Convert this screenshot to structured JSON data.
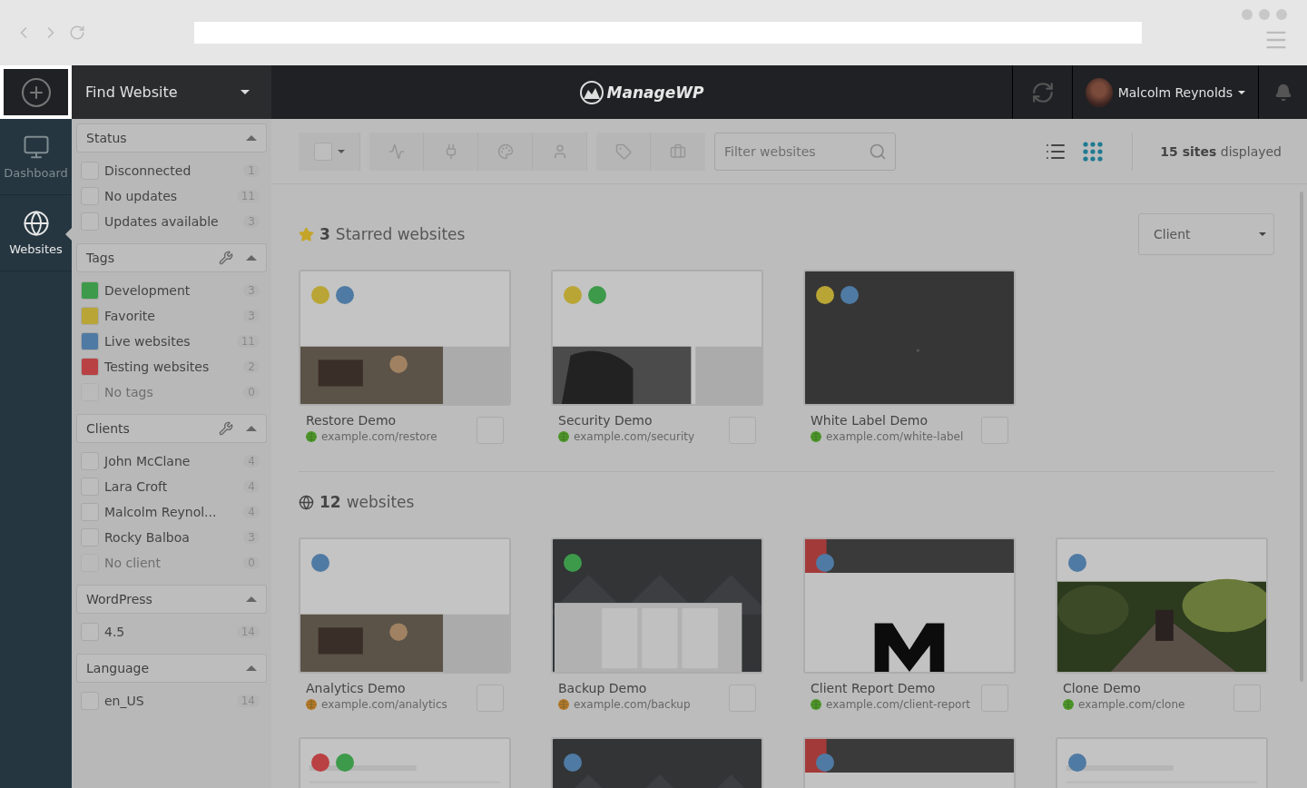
{
  "header": {
    "find_website": "Find Website",
    "logo": "ManageWP",
    "user": "Malcolm Reynolds"
  },
  "nav": [
    {
      "label": "Dashboard",
      "selected": false
    },
    {
      "label": "Websites",
      "selected": true
    }
  ],
  "filters": [
    {
      "title": "Status",
      "wrench": false,
      "items": [
        {
          "kind": "checkbox",
          "label": "Disconnected",
          "count": "1",
          "disabled": false
        },
        {
          "kind": "checkbox",
          "label": "No updates",
          "count": "11",
          "disabled": false
        },
        {
          "kind": "checkbox",
          "label": "Updates available",
          "count": "3",
          "disabled": false
        }
      ]
    },
    {
      "title": "Tags",
      "wrench": true,
      "items": [
        {
          "kind": "tag",
          "label": "Development",
          "count": "3",
          "color": "#3d9a4a",
          "disabled": false
        },
        {
          "kind": "tag",
          "label": "Favorite",
          "count": "3",
          "color": "#b9a535",
          "disabled": false
        },
        {
          "kind": "tag",
          "label": "Live websites",
          "count": "11",
          "color": "#4f7aa3",
          "disabled": false
        },
        {
          "kind": "tag",
          "label": "Testing websites",
          "count": "2",
          "color": "#b94143",
          "disabled": false
        },
        {
          "kind": "checkbox",
          "label": "No tags",
          "count": "0",
          "disabled": true
        }
      ]
    },
    {
      "title": "Clients",
      "wrench": true,
      "items": [
        {
          "kind": "checkbox",
          "label": "John McClane",
          "count": "4",
          "disabled": false
        },
        {
          "kind": "checkbox",
          "label": "Lara Croft",
          "count": "4",
          "disabled": false
        },
        {
          "kind": "checkbox",
          "label": "Malcolm Reynol...",
          "count": "4",
          "disabled": false
        },
        {
          "kind": "checkbox",
          "label": "Rocky Balboa",
          "count": "3",
          "disabled": false
        },
        {
          "kind": "checkbox",
          "label": "No client",
          "count": "0",
          "disabled": true
        }
      ]
    },
    {
      "title": "WordPress",
      "wrench": false,
      "items": [
        {
          "kind": "checkbox",
          "label": "4.5",
          "count": "14",
          "disabled": false
        }
      ]
    },
    {
      "title": "Language",
      "wrench": false,
      "items": [
        {
          "kind": "checkbox",
          "label": "en_US",
          "count": "14",
          "disabled": false
        }
      ]
    }
  ],
  "toolbar": {
    "placeholder": "Filter websites",
    "views": [
      {
        "selected": false
      },
      {
        "selected": true
      }
    ],
    "sites_count": "**15 sites** displayed"
  },
  "sort": "Client",
  "groups": [
    {
      "count": "3",
      "heading": "Starred websites",
      "sites": [
        {
          "title": "Restore Demo",
          "url": "example.com/restore",
          "color": "#4f9a2c",
          "selected": false,
          "tags": [
            {
              "color": "#b9a535"
            },
            {
              "color": "#4f7aa3"
            }
          ]
        },
        {
          "title": "Security Demo",
          "url": "example.com/security",
          "color": "#4f9a2c",
          "selected": false,
          "tags": [
            {
              "color": "#b9a535"
            },
            {
              "color": "#3d9a4a"
            }
          ]
        },
        {
          "title": "White Label Demo",
          "url": "example.com/white-label",
          "color": "#4f9a2c",
          "selected": false,
          "tags": [
            {
              "color": "#b9a535"
            },
            {
              "color": "#4f7aa3"
            }
          ]
        }
      ]
    },
    {
      "count": "12",
      "heading": "websites",
      "sites": [
        {
          "title": "Analytics Demo",
          "url": "example.com/analytics",
          "color": "#b97a2c",
          "selected": false,
          "tags": [
            {
              "color": "#4f7aa3"
            }
          ]
        },
        {
          "title": "Backup Demo",
          "url": "example.com/backup",
          "color": "#b97a2c",
          "selected": false,
          "tags": [
            {
              "color": "#3d9a4a"
            }
          ]
        },
        {
          "title": "Client Report Demo",
          "url": "example.com/client-report",
          "color": "#4f9a2c",
          "selected": false,
          "tags": [
            {
              "color": "#4f7aa3"
            }
          ]
        },
        {
          "title": "Clone Demo",
          "url": "example.com/clone",
          "color": "#4f9a2c",
          "selected": false,
          "tags": [
            {
              "color": "#4f7aa3"
            }
          ]
        },
        {
          "tags": [
            {
              "color": "#b94143"
            },
            {
              "color": "#3d9a4a"
            }
          ]
        },
        {
          "tags": [
            {
              "color": "#4f7aa3"
            }
          ]
        },
        {
          "tags": [
            {
              "color": "#4f7aa3"
            }
          ]
        },
        {
          "tags": [
            {
              "color": "#4f7aa3"
            }
          ]
        }
      ]
    }
  ]
}
